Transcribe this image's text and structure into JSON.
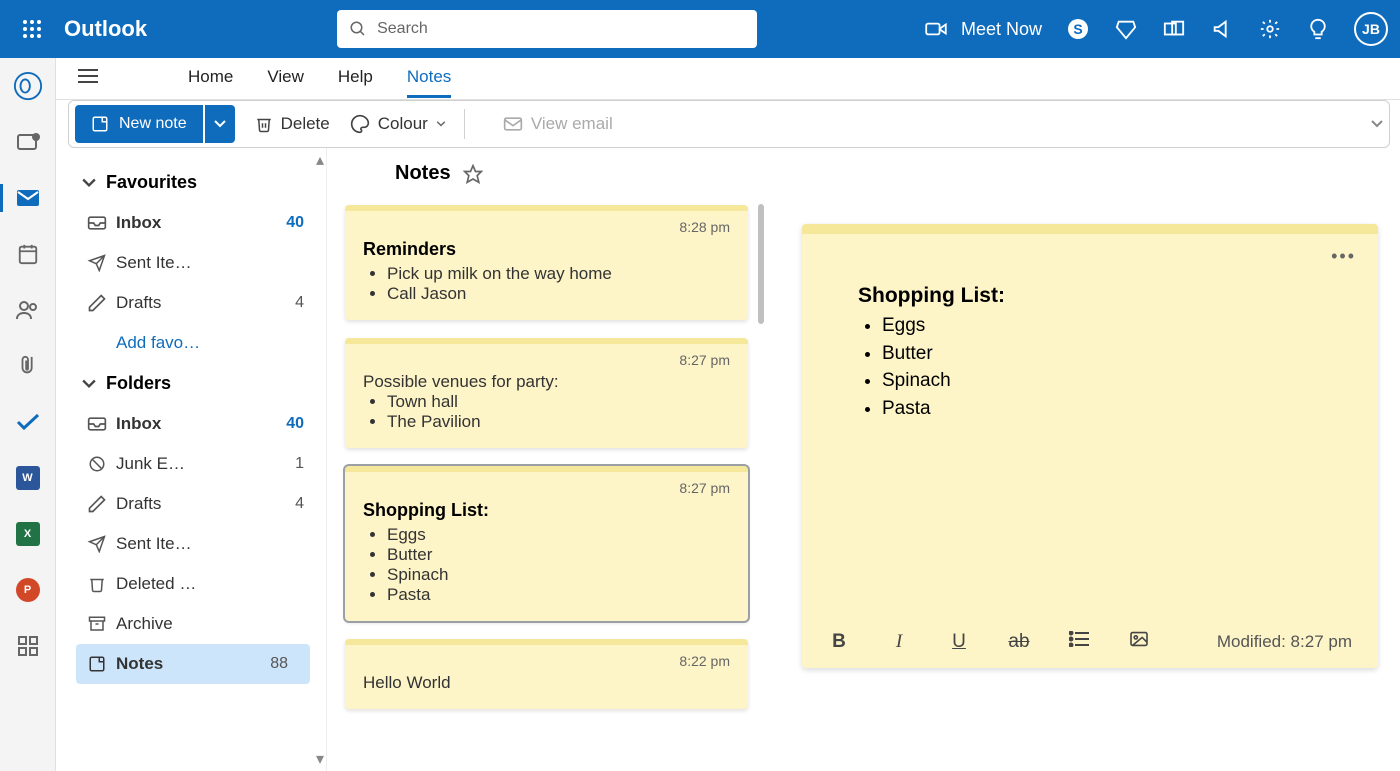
{
  "brand": "Outlook",
  "search_placeholder": "Search",
  "meet_now": "Meet Now",
  "avatar_initials": "JB",
  "tabs": {
    "home": "Home",
    "view": "View",
    "help": "Help",
    "notes": "Notes"
  },
  "toolbar": {
    "new_note": "New note",
    "delete": "Delete",
    "colour": "Colour",
    "view_email": "View email"
  },
  "nav": {
    "favourites": "Favourites",
    "folders": "Folders",
    "add_favourite": "Add favo…",
    "items": {
      "fav_inbox": {
        "label": "Inbox",
        "count": "40"
      },
      "fav_sent": {
        "label": "Sent Ite…"
      },
      "fav_drafts": {
        "label": "Drafts",
        "count": "4"
      },
      "inbox": {
        "label": "Inbox",
        "count": "40"
      },
      "junk": {
        "label": "Junk E…",
        "count": "1"
      },
      "drafts": {
        "label": "Drafts",
        "count": "4"
      },
      "sent": {
        "label": "Sent Ite…"
      },
      "deleted": {
        "label": "Deleted …"
      },
      "archive": {
        "label": "Archive"
      },
      "notes": {
        "label": "Notes",
        "count": "88"
      }
    }
  },
  "list_header": "Notes",
  "notes": [
    {
      "time": "8:28 pm",
      "title": "Reminders",
      "body_html": "<ul><li>Pick up milk on the way home</li><li>Call Jason</li></ul>"
    },
    {
      "time": "8:27 pm",
      "title": "",
      "body_html": "Possible venues for party:<ul><li>Town hall</li><li>The Pavilion</li></ul>"
    },
    {
      "time": "8:27 pm",
      "title": "Shopping List:",
      "body_html": "<ul><li>Eggs</li><li>Butter</li><li>Spinach</li><li>Pasta</li></ul>",
      "selected": true
    },
    {
      "time": "8:22 pm",
      "title": "",
      "body_html": "Hello World"
    }
  ],
  "detail": {
    "title": "Shopping List:",
    "items": [
      "Eggs",
      "Butter",
      "Spinach",
      "Pasta"
    ],
    "modified": "Modified: 8:27 pm"
  }
}
